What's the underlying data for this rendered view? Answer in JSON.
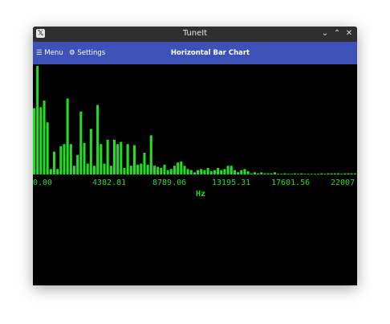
{
  "window": {
    "title": "TuneIt",
    "app_icon": "x-logo-icon",
    "controls": [
      "minimize",
      "maximize",
      "close"
    ]
  },
  "toolbar": {
    "menu_label": "☰ Menu",
    "settings_label": "⚙ Settings",
    "title": "Horizontal Bar Chart"
  },
  "colors": {
    "bar": "#22dd22",
    "axis_text": "#22dd22",
    "background": "#000000",
    "toolbar": "#3d51b8",
    "titlebar": "#2f2f2f"
  },
  "chart_data": {
    "type": "bar",
    "title": "Horizontal Bar Chart",
    "xlabel": "Hz",
    "ylabel": "",
    "x_ticks": [
      "0.00",
      "4382.81",
      "8789.06",
      "13195.31",
      "17601.56",
      "22007"
    ],
    "xlim": [
      0,
      22007
    ],
    "ylim": [
      0,
      1
    ],
    "values": [
      0.61,
      1.0,
      0.62,
      0.68,
      0.48,
      0.05,
      0.21,
      0.05,
      0.26,
      0.28,
      0.7,
      0.28,
      0.08,
      0.18,
      0.58,
      0.29,
      0.1,
      0.42,
      0.08,
      0.64,
      0.28,
      0.1,
      0.32,
      0.08,
      0.32,
      0.28,
      0.3,
      0.06,
      0.28,
      0.08,
      0.27,
      0.09,
      0.1,
      0.2,
      0.09,
      0.36,
      0.08,
      0.07,
      0.06,
      0.09,
      0.04,
      0.05,
      0.08,
      0.11,
      0.12,
      0.08,
      0.05,
      0.04,
      0.02,
      0.04,
      0.05,
      0.04,
      0.06,
      0.03,
      0.04,
      0.06,
      0.04,
      0.05,
      0.08,
      0.08,
      0.04,
      0.02,
      0.04,
      0.05,
      0.03,
      0.01,
      0.02,
      0.01,
      0.02,
      0.01,
      0.01,
      0.01,
      0.02,
      0.0,
      0.0,
      0.01,
      0.0,
      0.0,
      0.01,
      0.0,
      0.01,
      0.0,
      0.0,
      0.0,
      0.0,
      0.0,
      0.01,
      0.0,
      0.01,
      0.01,
      0.01,
      0.01,
      0.0,
      0.01,
      0.01,
      0.01,
      0.01
    ]
  }
}
